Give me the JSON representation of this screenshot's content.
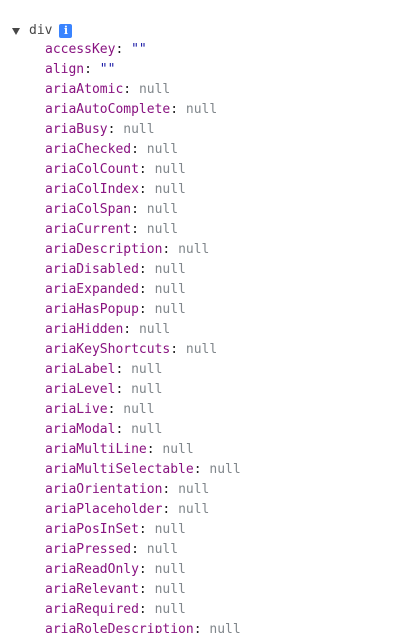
{
  "header": {
    "expand_glyph": "▼",
    "tag": "div",
    "info_icon": "info-icon",
    "info_glyph": "i"
  },
  "separator": ": ",
  "properties": [
    {
      "key": "accessKey",
      "value": "\"\"",
      "kind": "string"
    },
    {
      "key": "align",
      "value": "\"\"",
      "kind": "string"
    },
    {
      "key": "ariaAtomic",
      "value": "null",
      "kind": "null"
    },
    {
      "key": "ariaAutoComplete",
      "value": "null",
      "kind": "null"
    },
    {
      "key": "ariaBusy",
      "value": "null",
      "kind": "null"
    },
    {
      "key": "ariaChecked",
      "value": "null",
      "kind": "null"
    },
    {
      "key": "ariaColCount",
      "value": "null",
      "kind": "null"
    },
    {
      "key": "ariaColIndex",
      "value": "null",
      "kind": "null"
    },
    {
      "key": "ariaColSpan",
      "value": "null",
      "kind": "null"
    },
    {
      "key": "ariaCurrent",
      "value": "null",
      "kind": "null"
    },
    {
      "key": "ariaDescription",
      "value": "null",
      "kind": "null"
    },
    {
      "key": "ariaDisabled",
      "value": "null",
      "kind": "null"
    },
    {
      "key": "ariaExpanded",
      "value": "null",
      "kind": "null"
    },
    {
      "key": "ariaHasPopup",
      "value": "null",
      "kind": "null"
    },
    {
      "key": "ariaHidden",
      "value": "null",
      "kind": "null"
    },
    {
      "key": "ariaKeyShortcuts",
      "value": "null",
      "kind": "null"
    },
    {
      "key": "ariaLabel",
      "value": "null",
      "kind": "null"
    },
    {
      "key": "ariaLevel",
      "value": "null",
      "kind": "null"
    },
    {
      "key": "ariaLive",
      "value": "null",
      "kind": "null"
    },
    {
      "key": "ariaModal",
      "value": "null",
      "kind": "null"
    },
    {
      "key": "ariaMultiLine",
      "value": "null",
      "kind": "null"
    },
    {
      "key": "ariaMultiSelectable",
      "value": "null",
      "kind": "null"
    },
    {
      "key": "ariaOrientation",
      "value": "null",
      "kind": "null"
    },
    {
      "key": "ariaPlaceholder",
      "value": "null",
      "kind": "null"
    },
    {
      "key": "ariaPosInSet",
      "value": "null",
      "kind": "null"
    },
    {
      "key": "ariaPressed",
      "value": "null",
      "kind": "null"
    },
    {
      "key": "ariaReadOnly",
      "value": "null",
      "kind": "null"
    },
    {
      "key": "ariaRelevant",
      "value": "null",
      "kind": "null"
    },
    {
      "key": "ariaRequired",
      "value": "null",
      "kind": "null"
    },
    {
      "key": "ariaRoleDescription",
      "value": "null",
      "kind": "null"
    }
  ],
  "colors": {
    "key": "#881280",
    "null": "#80868b",
    "string": "#1a1aa6",
    "info_badge": "#3a84ff"
  }
}
